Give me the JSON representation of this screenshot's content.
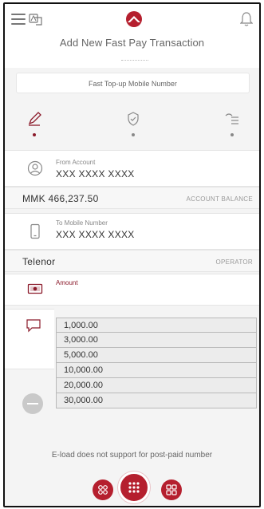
{
  "header": {
    "title": "Add New Fast Pay Transaction",
    "logo": "brand-logo",
    "accent_color": "#8b1a2a"
  },
  "service": {
    "label": "Fast Top-up Mobile Number"
  },
  "steps": [
    {
      "icon": "pencil-icon",
      "active": true
    },
    {
      "icon": "shield-check-icon",
      "active": false
    },
    {
      "icon": "list-arrow-icon",
      "active": false
    }
  ],
  "from_account": {
    "label": "From Account",
    "value": "XXX XXXX XXXX"
  },
  "balance": {
    "value": "MMK 466,237.50",
    "caption": "ACCOUNT BALANCE"
  },
  "to_mobile": {
    "label": "To Mobile Number",
    "value": "XXX XXXX XXXX"
  },
  "operator": {
    "value": "Telenor",
    "caption": "OPERATOR"
  },
  "amount": {
    "label": "Amount",
    "options": [
      "1,000.00",
      "3,000.00",
      "5,000.00",
      "10,000.00",
      "20,000.00",
      "30,000.00"
    ]
  },
  "note": "E-load does not support for post-paid number"
}
